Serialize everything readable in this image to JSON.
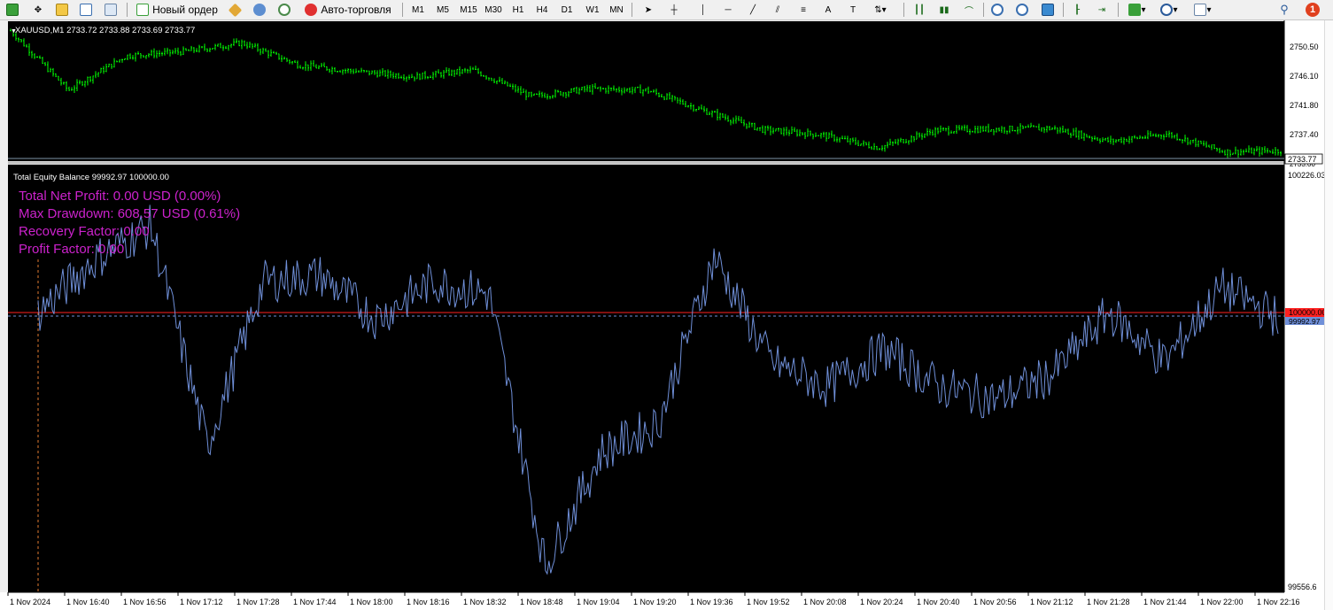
{
  "toolbar": {
    "new_order_label": "Новый ордер",
    "autotrading_label": "Авто-торговля",
    "timeframes": [
      "M1",
      "M5",
      "M15",
      "M30",
      "H1",
      "H4",
      "D1",
      "W1",
      "MN"
    ],
    "notification_count": "1"
  },
  "price_pane": {
    "header": "XAUUSD,M1  2733.72 2733.88 2733.69 2733.77",
    "y_ticks": [
      "2750.50",
      "2746.10",
      "2741.80",
      "2737.40",
      "2733.77",
      "2733.00"
    ],
    "current_price_label": "2733.77",
    "bar_color": "#00ff00"
  },
  "equity_pane": {
    "header": "Total Equity Balance 99992.97 100000.00",
    "stats": [
      "Total Net Profit: 0.00 USD (0.00%)",
      "Max Drawdown: 608.57 USD (0.61%)",
      "Recovery Factor: 0.00",
      "Profit Factor: 0.00"
    ],
    "stats_color": "#cc22cc",
    "y_ticks": [
      "100226.03",
      "99556.6"
    ],
    "balance_label": "100000.00",
    "equity_label": "99992.97",
    "balance_line_color": "#ff2020",
    "equity_line_color": "#6f8fd8"
  },
  "time_axis": [
    "1 Nov 2024",
    "1 Nov 16:40",
    "1 Nov 16:56",
    "1 Nov 17:12",
    "1 Nov 17:28",
    "1 Nov 17:44",
    "1 Nov 18:00",
    "1 Nov 18:16",
    "1 Nov 18:32",
    "1 Nov 18:48",
    "1 Nov 19:04",
    "1 Nov 19:20",
    "1 Nov 19:36",
    "1 Nov 19:52",
    "1 Nov 20:08",
    "1 Nov 20:24",
    "1 Nov 20:40",
    "1 Nov 20:56",
    "1 Nov 21:12",
    "1 Nov 21:28",
    "1 Nov 21:44",
    "1 Nov 22:00",
    "1 Nov 22:16"
  ],
  "chart_data": [
    {
      "type": "line",
      "title": "XAUUSD,M1",
      "ylim": [
        2733.0,
        2752.0
      ],
      "x": [
        "1 Nov 2024",
        "16:40",
        "16:56",
        "17:12",
        "17:28",
        "17:44",
        "18:00",
        "18:16",
        "18:32",
        "18:48",
        "19:04",
        "19:20",
        "19:36",
        "19:52",
        "20:08",
        "20:24",
        "20:40",
        "20:56",
        "21:12",
        "21:28",
        "21:44",
        "22:00",
        "22:16"
      ],
      "series": [
        {
          "name": "XAUUSD",
          "values": [
            2751.3,
            2743.0,
            2747.8,
            2748.4,
            2749.6,
            2746.5,
            2745.6,
            2744.9,
            2745.8,
            2742.1,
            2743.2,
            2743.0,
            2740.1,
            2737.5,
            2736.8,
            2735.0,
            2737.4,
            2737.6,
            2737.7,
            2735.9,
            2736.9,
            2734.4,
            2734.6
          ]
        }
      ]
    },
    {
      "type": "line",
      "title": "Total Equity Balance",
      "ylim": [
        99556.6,
        100226.03
      ],
      "x": [
        "1 Nov 2024",
        "16:40",
        "16:56",
        "17:12",
        "17:28",
        "17:44",
        "18:00",
        "18:16",
        "18:32",
        "18:48",
        "19:04",
        "19:20",
        "19:36",
        "19:52",
        "20:08",
        "20:24",
        "20:40",
        "20:56",
        "21:12",
        "21:28",
        "21:44",
        "22:00",
        "22:16"
      ],
      "series": [
        {
          "name": "Equity",
          "values": [
            100000,
            100085,
            100140,
            99785,
            100050,
            100060,
            99990,
            100050,
            100030,
            99590,
            99775,
            99820,
            100090,
            99920,
            99880,
            99940,
            99880,
            99860,
            99900,
            100000,
            99920,
            100040,
            99993
          ]
        },
        {
          "name": "Balance",
          "values": [
            100000,
            100000,
            100000,
            100000,
            100000,
            100000,
            100000,
            100000,
            100000,
            100000,
            100000,
            100000,
            100000,
            100000,
            100000,
            100000,
            100000,
            100000,
            100000,
            100000,
            100000,
            100000,
            100000
          ]
        }
      ]
    }
  ]
}
